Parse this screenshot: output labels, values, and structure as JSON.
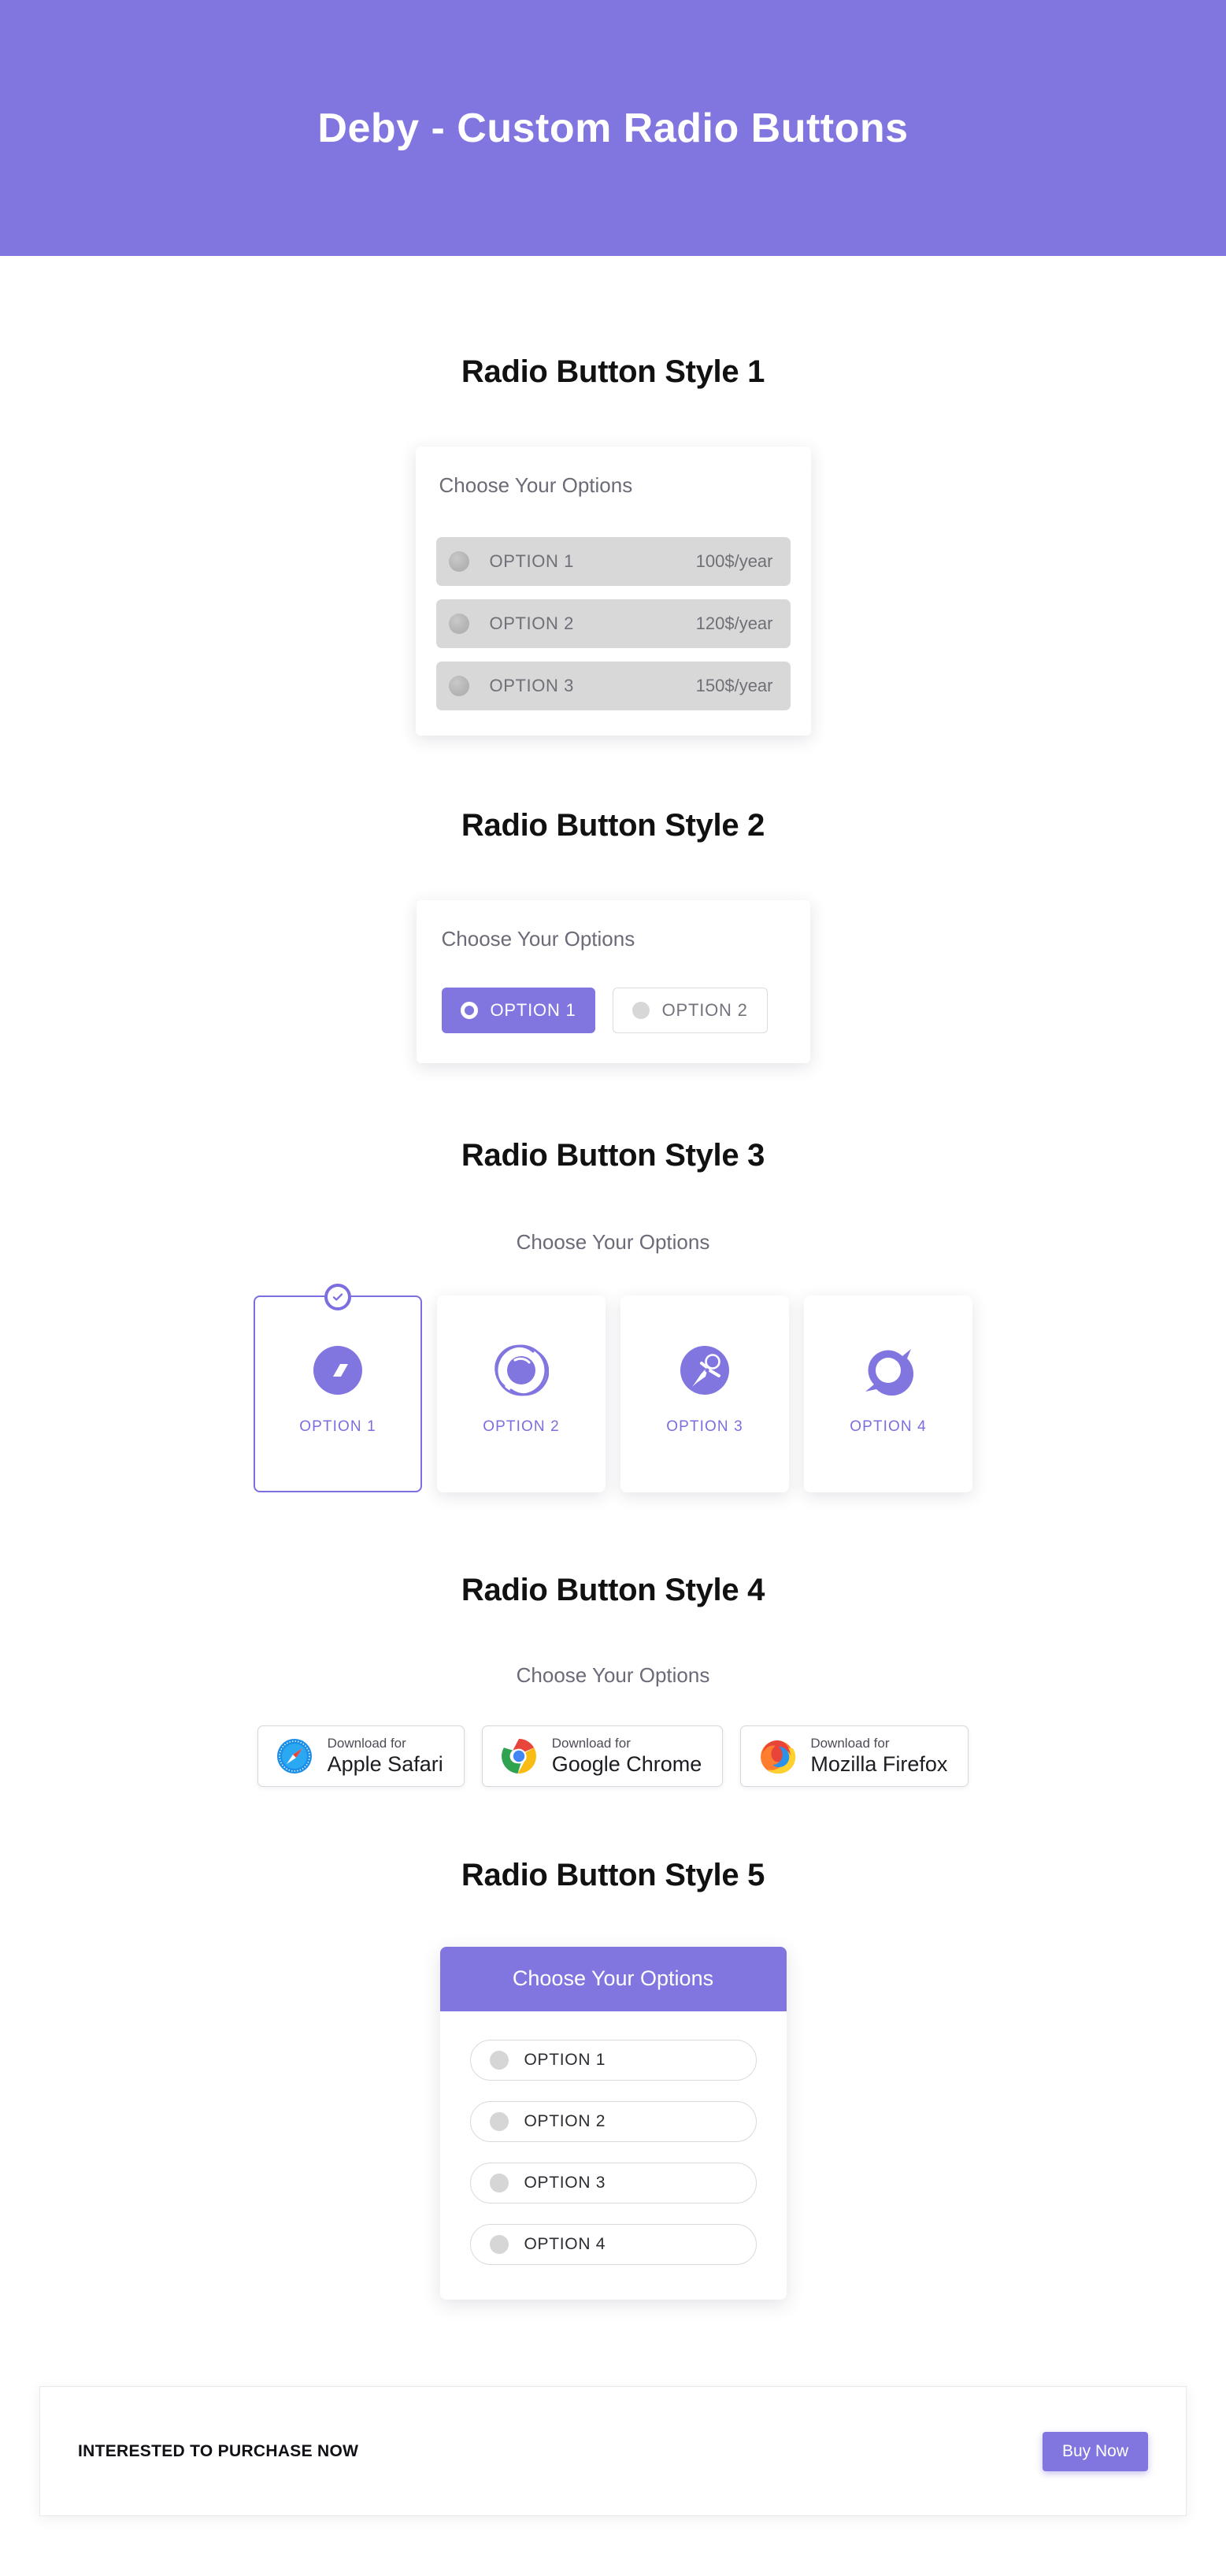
{
  "theme": {
    "accent": "#8175e0",
    "accent_border": "#7a6ee0",
    "option_grey": "#d8d8d8",
    "dot_grey": "#d6d6d6",
    "page_bg": "#ffffff",
    "heading_color": "#111111",
    "muted_text": "#6b6b78"
  },
  "header": {
    "title": "Deby - Custom Radio Buttons"
  },
  "style1": {
    "title": "Radio Button Style 1",
    "card_label": "Choose Your Options",
    "options": [
      {
        "name": "OPTION 1",
        "price": "100$/year",
        "icon": "radio-dot-icon",
        "selected": false
      },
      {
        "name": "OPTION 2",
        "price": "120$/year",
        "icon": "radio-dot-icon",
        "selected": false
      },
      {
        "name": "OPTION 3",
        "price": "150$/year",
        "icon": "radio-dot-icon",
        "selected": false
      }
    ]
  },
  "style2": {
    "title": "Radio Button Style 2",
    "card_label": "Choose Your Options",
    "options": [
      {
        "name": "OPTION 1",
        "icon": "radio-ring-icon",
        "selected": true
      },
      {
        "name": "OPTION 2",
        "icon": "radio-dot-icon",
        "selected": false
      }
    ]
  },
  "style3": {
    "title": "Radio Button Style 3",
    "card_label": "Choose Your Options",
    "check_icon": "check-icon",
    "options": [
      {
        "name": "OPTION 1",
        "icon": "parallelogram-circle-icon",
        "selected": true
      },
      {
        "name": "OPTION 2",
        "icon": "spiral-circle-icon",
        "selected": false
      },
      {
        "name": "OPTION 3",
        "icon": "astronaut-circle-icon",
        "selected": false
      },
      {
        "name": "OPTION 4",
        "icon": "abstract-o-icon",
        "selected": false
      }
    ]
  },
  "style4": {
    "title": "Radio Button Style 4",
    "card_label": "Choose Your Options",
    "options": [
      {
        "prefix": "Download for",
        "name": "Apple Safari",
        "icon": "safari-icon",
        "selected": false
      },
      {
        "prefix": "Download for",
        "name": "Google Chrome",
        "icon": "chrome-icon",
        "selected": false
      },
      {
        "prefix": "Download for",
        "name": "Mozilla Firefox",
        "icon": "firefox-icon",
        "selected": false
      }
    ]
  },
  "style5": {
    "title": "Radio Button Style 5",
    "card_label": "Choose Your Options",
    "options": [
      {
        "name": "OPTION 1",
        "icon": "radio-dot-icon",
        "selected": false
      },
      {
        "name": "OPTION 2",
        "icon": "radio-dot-icon",
        "selected": false
      },
      {
        "name": "OPTION 3",
        "icon": "radio-dot-icon",
        "selected": false
      },
      {
        "name": "OPTION 4",
        "icon": "radio-dot-icon",
        "selected": false
      }
    ]
  },
  "footer": {
    "text": "INTERESTED TO PURCHASE NOW",
    "buy_label": "Buy Now"
  }
}
